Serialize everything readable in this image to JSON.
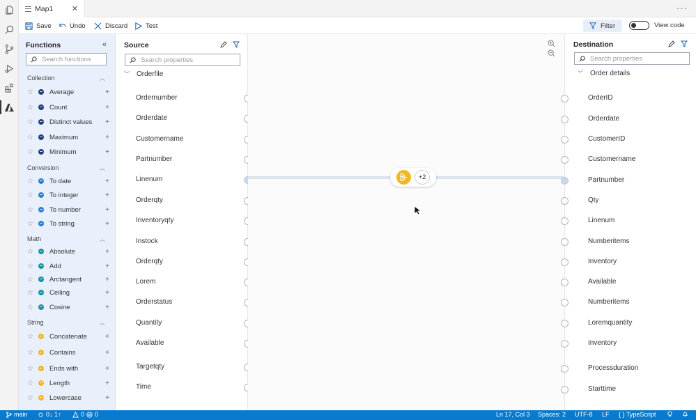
{
  "tab": {
    "title": "Map1"
  },
  "toolbar": {
    "save": "Save",
    "undo": "Undo",
    "discard": "Discard",
    "test": "Test",
    "filter": "Filter",
    "view_code": "View code"
  },
  "functions": {
    "title": "Functions",
    "search_placeholder": "Search functions",
    "categories": [
      {
        "name": "Collection",
        "items": [
          {
            "label": "Average",
            "color": "#1f3f7a"
          },
          {
            "label": "Count",
            "color": "#1f3f7a"
          },
          {
            "label": "Distinct values",
            "color": "#1f3f7a"
          },
          {
            "label": "Maximum",
            "color": "#1f3f7a"
          },
          {
            "label": "Minimum",
            "color": "#1f3f7a"
          }
        ]
      },
      {
        "name": "Conversion",
        "items": [
          {
            "label": "To date",
            "color": "#2d7fd6"
          },
          {
            "label": "To integer",
            "color": "#2d7fd6"
          },
          {
            "label": "To number",
            "color": "#2d7fd6"
          },
          {
            "label": "To string",
            "color": "#2d7fd6"
          }
        ]
      },
      {
        "name": "Math",
        "items": [
          {
            "label": "Absolute",
            "color": "#1793a8"
          },
          {
            "label": "Add",
            "color": "#1793a8"
          },
          {
            "label": "Arctangent",
            "color": "#1793a8"
          },
          {
            "label": "Ceiling",
            "color": "#1793a8"
          },
          {
            "label": "Cosine",
            "color": "#1793a8"
          }
        ]
      },
      {
        "name": "String",
        "items": [
          {
            "label": "Concatenate",
            "color": "#f2b824"
          },
          {
            "label": "Contains",
            "color": "#f2b824"
          },
          {
            "label": "Ends with",
            "color": "#f2b824"
          },
          {
            "label": "Length",
            "color": "#f2b824"
          },
          {
            "label": "Lowercase",
            "color": "#f2b824"
          }
        ]
      }
    ]
  },
  "source": {
    "title": "Source",
    "search_placeholder": "Search properties",
    "root": "Orderfile",
    "fields": [
      "Ordernumber",
      "Orderdate",
      "Customername",
      "Partnumber",
      "Linenum",
      "Orderqty",
      "Inventoryqty",
      "Instock",
      "Orderqty",
      "Lorem",
      "Orderstatus",
      "Quantity",
      "Available",
      "Targetqty",
      "Time"
    ]
  },
  "destination": {
    "title": "Destination",
    "search_placeholder": "Search properties",
    "root": "Order details",
    "fields": [
      "OrderID",
      "Orderdate",
      "CustomerID",
      "Customername",
      "Partnumber",
      "Qty",
      "Linenum",
      "Numberitems",
      "Inventory",
      "Available",
      "Numberitems",
      "Loremquantity",
      "Inventory",
      "Processduration",
      "Starttime"
    ]
  },
  "canvas": {
    "function_count_badge": "+2",
    "connection": {
      "from": "Linenum",
      "to": "Partnumber"
    }
  },
  "statusbar": {
    "branch": "main",
    "sync": "0↓ 1↑",
    "problems": "0",
    "errors": "0",
    "position": "Ln 17, Col 3",
    "spaces": "Spaces: 2",
    "encoding": "UTF-8",
    "eol": "LF",
    "language": "{ } TypeScript"
  }
}
